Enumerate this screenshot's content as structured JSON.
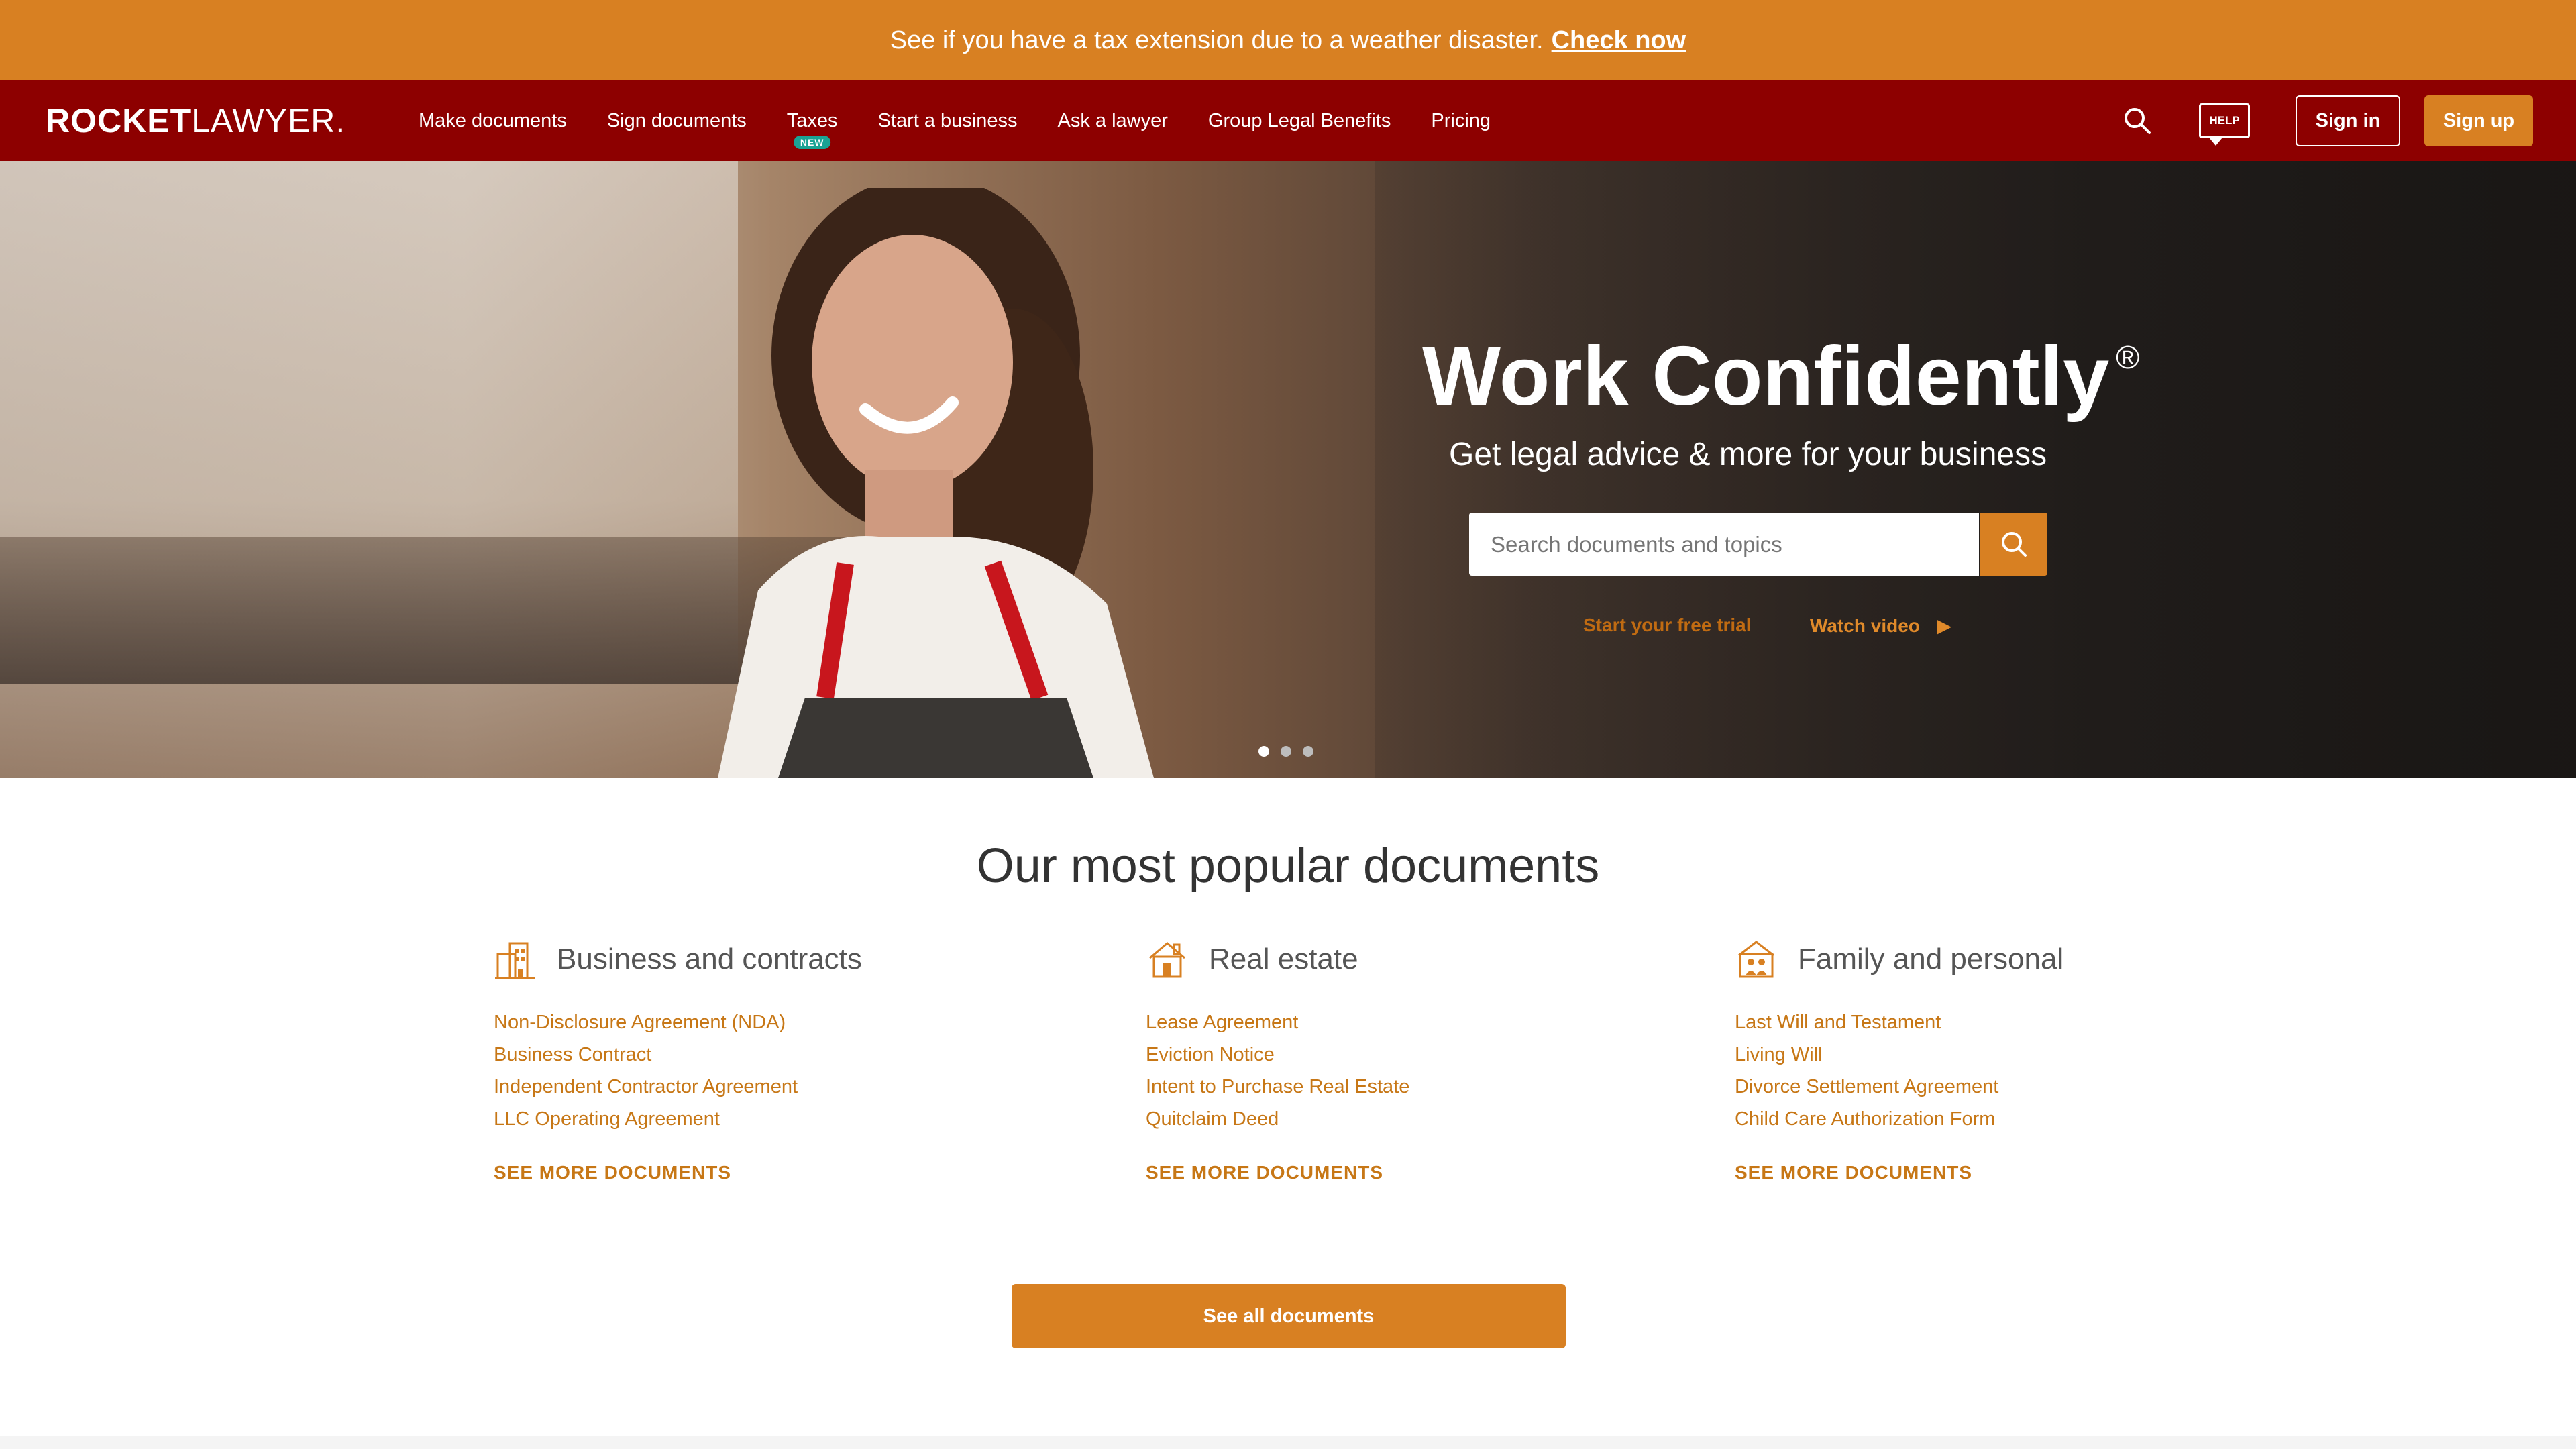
{
  "alert": {
    "text": "See if you have a tax extension due to a weather disaster.",
    "link": "Check now"
  },
  "nav": {
    "logo_bold": "ROCKET",
    "logo_light": "LAWYER",
    "logo_mark": ".",
    "links": [
      "Make documents",
      "Sign documents",
      "Taxes",
      "Start a business",
      "Ask a lawyer",
      "Group Legal Benefits",
      "Pricing"
    ],
    "taxes_badge": "NEW",
    "help_label": "HELP",
    "signin": "Sign in",
    "signup": "Sign up"
  },
  "hero": {
    "title": "Work Confidently",
    "title_mark": "®",
    "subtitle": "Get legal advice & more for your business",
    "search_placeholder": "Search documents and topics",
    "trial_link": "Start your free trial",
    "video_link": "Watch video",
    "video_arrow": "▶",
    "slides": 3,
    "active_slide": 1
  },
  "popular": {
    "title": "Our most popular documents",
    "columns": [
      {
        "title": "Business and contracts",
        "icon": "building-icon",
        "items": [
          "Non-Disclosure Agreement (NDA)",
          "Business Contract",
          "Independent Contractor Agreement",
          "LLC Operating Agreement"
        ],
        "see_more": "SEE MORE DOCUMENTS"
      },
      {
        "title": "Real estate",
        "icon": "house-icon",
        "items": [
          "Lease Agreement",
          "Eviction Notice",
          "Intent to Purchase Real Estate",
          "Quitclaim Deed"
        ],
        "see_more": "SEE MORE DOCUMENTS"
      },
      {
        "title": "Family and personal",
        "icon": "family-icon",
        "items": [
          "Last Will and Testament",
          "Living Will",
          "Divorce Settlement Agreement",
          "Child Care Authorization Form"
        ],
        "see_more": "SEE MORE DOCUMENTS"
      }
    ],
    "see_all": "See all documents"
  },
  "colors": {
    "alert_bg": "#d88022",
    "nav_bg": "#8d0000",
    "accent": "#d88022",
    "link": "#c77716"
  }
}
